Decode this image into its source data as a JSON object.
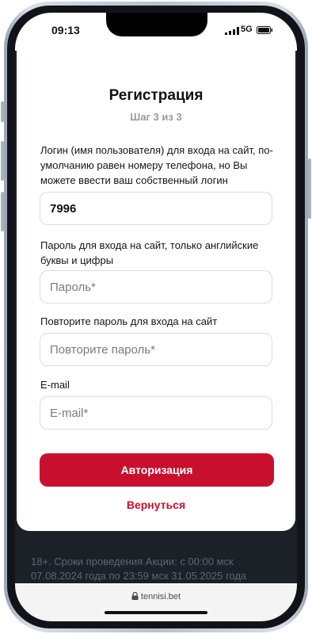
{
  "status_bar": {
    "time": "09:13",
    "network": "5G"
  },
  "form": {
    "title": "Регистрация",
    "step": "Шаг 3 из 3",
    "login": {
      "label": "Логин (имя пользователя) для входа на сайт, по-умолчанию равен номеру телефона, но Вы можете ввести ваш собственный логин",
      "value": "7996"
    },
    "password": {
      "label": "Пароль для входа на сайт, только английские буквы и цифры",
      "placeholder": "Пароль*"
    },
    "password_repeat": {
      "label": "Повторите пароль для входа на сайт",
      "placeholder": "Повторите пароль*"
    },
    "email": {
      "label": "E-mail",
      "placeholder": "E-mail*"
    },
    "submit_label": "Авторизация",
    "back_label": "Вернуться"
  },
  "footer": {
    "promo_text": "18+. Сроки проведения Акции: с 00:00 мск 07.08.2024 года по 23:59 мск 31.05.2025 года"
  },
  "browser": {
    "url": "tennisi.bet"
  },
  "colors": {
    "accent": "#c8102e",
    "backdrop": "#1c2128",
    "muted": "#9a9aa0"
  }
}
